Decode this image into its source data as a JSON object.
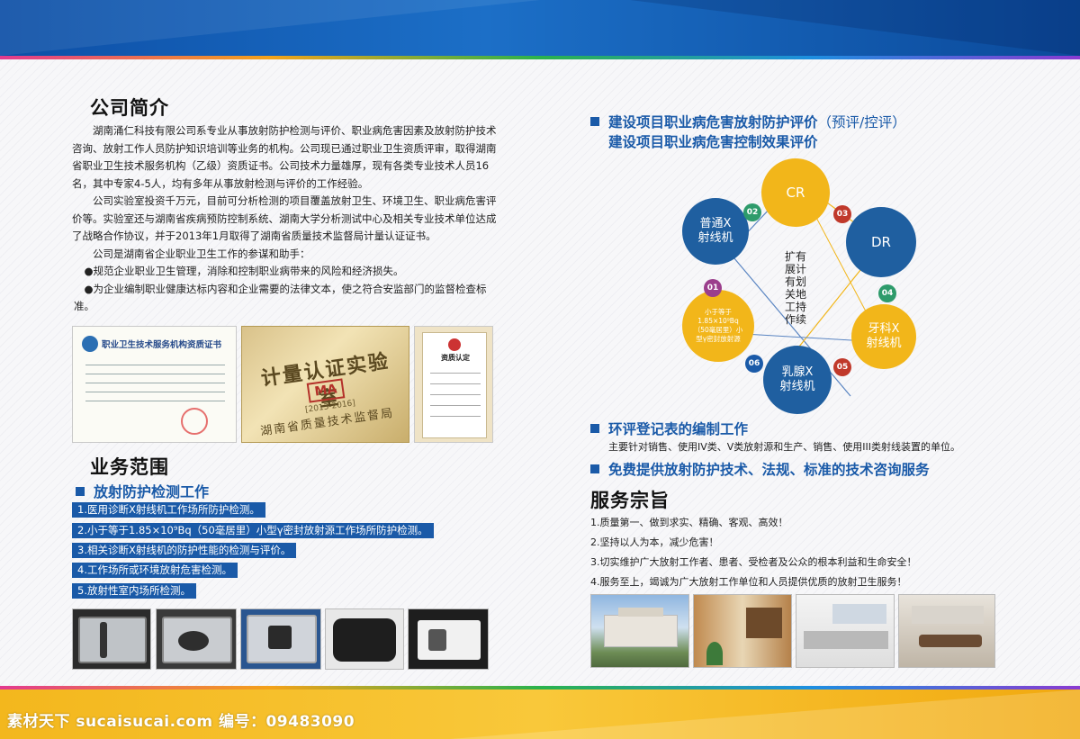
{
  "company": {
    "title": "公司简介",
    "paragraphs": [
      "湖南涌仁科技有限公司系专业从事放射防护检测与评价、职业病危害因素及放射防护技术咨询、放射工作人员防护知识培训等业务的机构。公司现已通过职业卫生资质评审，取得湖南省职业卫生技术服务机构（乙级）资质证书。公司技术力量雄厚，现有各类专业技术人员16名，其中专家4-5人，均有多年从事放射检测与评价的工作经验。",
      "公司实验室投资千万元，目前可分析检测的项目覆盖放射卫生、环境卫生、职业病危害评价等。实验室还与湖南省疾病预防控制系统、湖南大学分析测试中心及相关专业技术单位达成了战略合作协议，并于2013年1月取得了湖南省质量技术监督局计量认证证书。",
      "公司是湖南省企业职业卫生工作的参谋和助手："
    ],
    "bullets": [
      "●规范企业职业卫生管理，消除和控制职业病带来的风险和经济损失。",
      "●为企业编制职业健康达标内容和企业需要的法律文本，使之符合安监部门的监督检查标准。"
    ]
  },
  "certificates": {
    "cert1_title": "职业卫生技术服务机构资质证书",
    "cert2_line1": "计量认证实验室",
    "cert2_ma": "MA",
    "cert2_years": "[2013-2016]",
    "cert2_line2": "湖南省质量技术监督局",
    "cert3_title": "资质认定"
  },
  "business": {
    "title": "业务范围",
    "subtitle": "放射防护检测工作",
    "items": [
      "1.医用诊断X射线机工作场所防护检测。",
      "2.小于等于1.85×10⁹Bq（50毫居里）小型γ密封放射源工作场所防护检测。",
      "3.相关诊断X射线机的防护性能的检测与评价。",
      "4.工作场所或环境放射危害检测。",
      "5.放射性室内场所检测。"
    ]
  },
  "evaluation": {
    "title_line1_main": "建设项目职业病危害放射防护评价",
    "title_line1_paren": "（预评/控评）",
    "title_line2": "建设项目职业病危害控制效果评价"
  },
  "diagram": {
    "center": [
      "扩有",
      "展计",
      "有划",
      "关地",
      "工持",
      "作续"
    ],
    "nodes": [
      {
        "num": "01",
        "lines": [
          "小于等于",
          "1.85×10⁹Bq",
          "（50毫居里）小",
          "型γ密封放射源"
        ],
        "color": "#f2b61a"
      },
      {
        "num": "02",
        "lines": [
          "普通X",
          "射线机"
        ],
        "color": "#1f5fa0"
      },
      {
        "num": "03",
        "lines": [
          "CR"
        ],
        "color": "#f2b61a"
      },
      {
        "num": "04",
        "lines": [
          "DR"
        ],
        "color": "#1f5fa0"
      },
      {
        "num": "05",
        "lines": [
          "牙科X",
          "射线机"
        ],
        "color": "#f2b61a"
      },
      {
        "num": "06",
        "lines": [
          "乳腺X",
          "射线机"
        ],
        "color": "#1f5fa0"
      }
    ],
    "num_colors": {
      "01": "#9b3e8c",
      "02": "#2e9b6b",
      "03": "#c0392b",
      "04": "#2e9b6b",
      "05": "#c0392b",
      "06": "#1a5aa8"
    }
  },
  "env_form": {
    "title": "环评登记表的编制工作",
    "desc": "主要针对销售、使用IV类、V类放射源和生产、销售、使用III类射线装置的单位。"
  },
  "consult": {
    "title": "免费提供放射防护技术、法规、标准的技术咨询服务"
  },
  "aims": {
    "title": "服务宗旨",
    "items": [
      "1.质量第一、做到求实、精确、客观、高效！",
      "2.坚持以人为本，减少危害！",
      "3.切实维护广大放射工作者、患者、受检者及公众的根本利益和生命安全！",
      "4.服务至上，竭诚为广大放射工作单位和人员提供优质的放射卫生服务！"
    ]
  },
  "footer": {
    "watermark": "素材天下 sucaisucai.com   编号：09483090"
  }
}
